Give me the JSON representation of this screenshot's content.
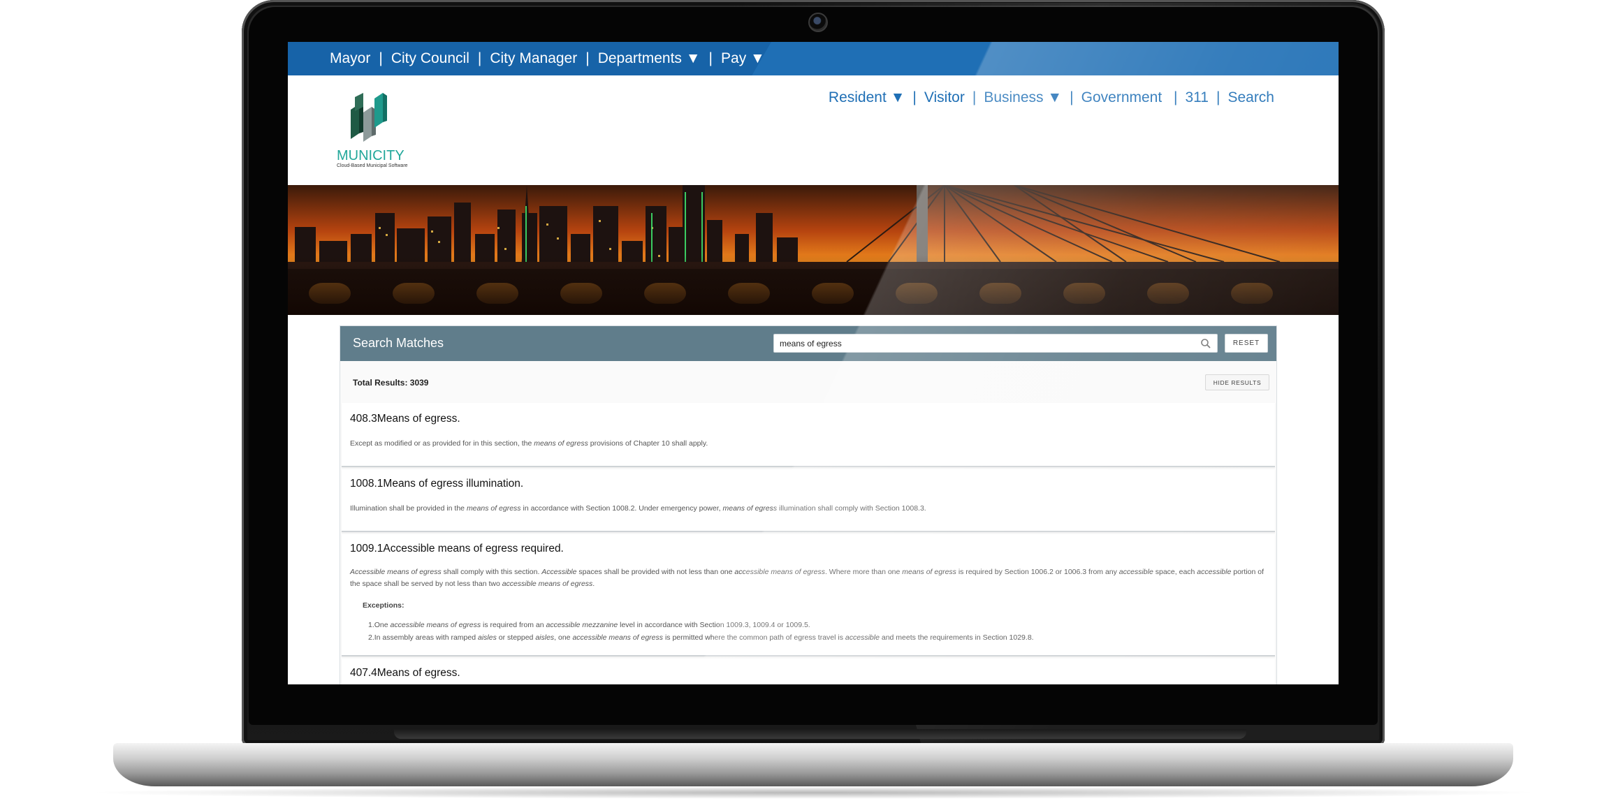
{
  "top_nav": {
    "items": [
      "Mayor",
      "City Council",
      "City Manager",
      "Departments ▼",
      "Pay ▼"
    ]
  },
  "secondary_nav": {
    "items": [
      "Resident ▼",
      "Visitor",
      "Business ▼",
      "Government",
      "311",
      "Search"
    ]
  },
  "logo": {
    "word": "MUNICITY",
    "tagline": "Cloud-Based Municipal Software"
  },
  "results_panel": {
    "title": "Search Matches",
    "search_value": "means of egress",
    "reset_label": "RESET",
    "total_label": "Total Results: 3039",
    "hide_label": "HIDE RESULTS"
  },
  "results": [
    {
      "title": "408.3Means of egress.",
      "text_pre": "Except as modified or as provided for in this section, the ",
      "text_em": "means of egress",
      "text_post": " provisions of Chapter 10 shall apply."
    },
    {
      "title": "1008.1Means of egress illumination.",
      "t1": "Illumination shall be provided in the ",
      "e1": "means of egress",
      "t2": " in accordance with Section 1008.2. Under emergency power, ",
      "e2": "means of egress",
      "t3": " illumination shall comply with Section 1008.3."
    },
    {
      "title": "1009.1Accessible means of egress required.",
      "p1": "Accessible means of egress",
      "p2": " shall comply with this section. ",
      "p3": "Accessible",
      "p4": " spaces shall be provided with not less than one ",
      "p5": "accessible means of egress",
      "p6": ". Where more than one ",
      "p7": "means of egress",
      "p8": " is required by Section 1006.2 or 1006.3 from any ",
      "p9": "accessible",
      "p10": " space, each ",
      "p11": "accessible",
      "p12": " portion of the space shall be served by not less than two ",
      "p13": "accessible means of egress",
      "p14": ".",
      "exceptions_label": "Exceptions:",
      "ex1_a": "1.One ",
      "ex1_b": "accessible means of egress",
      "ex1_c": " is required from an ",
      "ex1_d": "accessible mezzanine",
      "ex1_e": " level in accordance with Section 1009.3, 1009.4 or 1009.5.",
      "ex2_a": "2.In assembly areas with ramped ",
      "ex2_b": "aisles",
      "ex2_c": " or stepped ",
      "ex2_d": "aisles",
      "ex2_e": ", one ",
      "ex2_f": "accessible means of egress",
      "ex2_g": " is permitted where the common path of egress travel is ",
      "ex2_h": "accessible",
      "ex2_i": " and meets the requirements in Section 1029.8."
    },
    {
      "title": "407.4Means of egress."
    }
  ],
  "colors": {
    "topbar": "#1f6fb5",
    "panel_header": "#607d8b",
    "logo_teal": "#22a79a"
  },
  "icons": [
    "search-icon",
    "logo-icon",
    "webcam-icon"
  ]
}
